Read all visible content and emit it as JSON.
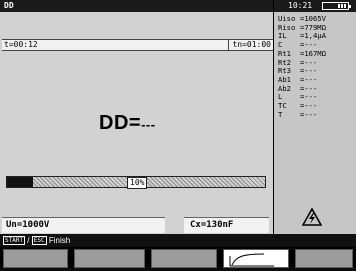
{
  "title": "DD",
  "clock": "10:21",
  "battery_icon": "battery-icon",
  "timer": {
    "elapsed": "t=00:12",
    "total": "tn=01:00"
  },
  "result": {
    "label": "DD=",
    "value": "---"
  },
  "progress": {
    "percent": 10,
    "label": "10%"
  },
  "bottom": {
    "voltage": "Un=1000V",
    "capacitance": "Cx=130nF"
  },
  "readings": [
    {
      "label": "Uiso",
      "value": "=1065V"
    },
    {
      "label": "Riso",
      "value": "=779MΩ"
    },
    {
      "label": "IL",
      "value": "=1,4µA"
    },
    {
      "label": "C",
      "value": "=---"
    },
    {
      "label": "Rt1",
      "value": "=167MΩ"
    },
    {
      "label": "Rt2",
      "value": "=---"
    },
    {
      "label": "Rt3",
      "value": "=---"
    },
    {
      "label": "Ab1",
      "value": "=---"
    },
    {
      "label": "Ab2",
      "value": "=---"
    },
    {
      "label": "L",
      "value": "=---"
    },
    {
      "label": "TC",
      "value": "=---"
    },
    {
      "label": "T",
      "value": "=---"
    }
  ],
  "help": {
    "key1": "START",
    "sep": "/",
    "key2": "ESC",
    "action": "Finish"
  },
  "softkeys": [
    {
      "name": "softkey-1",
      "icon": ""
    },
    {
      "name": "softkey-2",
      "icon": ""
    },
    {
      "name": "softkey-3",
      "icon": ""
    },
    {
      "name": "softkey-4",
      "icon": "graph-curve-icon"
    },
    {
      "name": "softkey-5",
      "icon": ""
    }
  ],
  "colors": {
    "panel": "#d2d2d2",
    "side": "#c6c6c6",
    "bar": "#111111"
  }
}
